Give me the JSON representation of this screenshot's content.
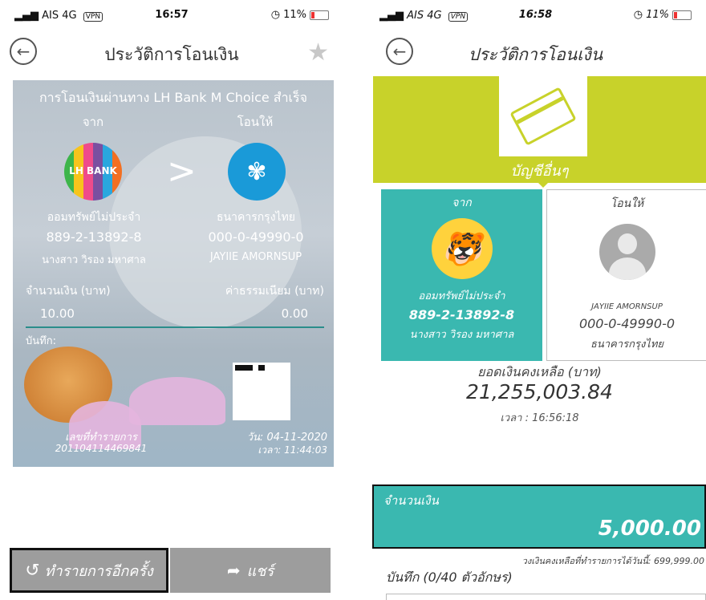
{
  "left": {
    "status": {
      "carrier": "AIS",
      "network": "4G",
      "vpn": "VPN",
      "time": "16:57",
      "battery": "11%"
    },
    "nav": {
      "title": "ประวัติการโอนเงิน"
    },
    "slip": {
      "headline": "การโอนเงินผ่านทาง LH Bank M Choice สำเร็จ",
      "from_label": "จาก",
      "to_label": "โอนให้",
      "from_logo_text": "LH BANK",
      "from_account_type": "ออมทรัพย์ไม่ประจำ",
      "from_account_no": "889-2-13892-8",
      "from_name": "นางสาว วิรอง มหาศาล",
      "to_bank": "ธนาคารกรุงไทย",
      "to_account_no": "000-0-49990-0",
      "to_name": "JAYIIE AMORNSUP",
      "amount_label": "จำนวนเงิน (บาท)",
      "amount": "10.00",
      "fee_label": "ค่าธรรมเนียม (บาท)",
      "fee": "0.00",
      "memo_label": "บันทึก:",
      "ref_label": "เลขที่ทำรายการ",
      "ref_no": "201104114469841",
      "date_label": "วัน: 04-11-2020",
      "time_label": "เวลา: 11:44:03"
    },
    "buttons": {
      "repeat": "ทำรายการอีกครั้ง",
      "share": "แชร์"
    }
  },
  "right": {
    "status": {
      "carrier": "AIS",
      "network": "4G",
      "vpn": "VPN",
      "time": "16:58",
      "battery": "11%"
    },
    "nav": {
      "title": "ประวัติการโอนเงิน"
    },
    "banner_label": "บัญชีอื่นๆ",
    "from": {
      "label": "จาก",
      "account_type": "ออมทรัพย์ไม่ประจำ",
      "account_no": "889-2-13892-8",
      "name": "นางสาว วิรอง มหาศาล"
    },
    "to": {
      "label": "โอนให้",
      "name": "JAYIIE AMORNSUP",
      "account_no": "000-0-49990-0",
      "bank": "ธนาคารกรุงไทย"
    },
    "balance": {
      "label": "ยอดเงินคงเหลือ (บาท)",
      "value": "21,255,003.84",
      "time": "เวลา : 16:56:18"
    },
    "amount": {
      "label": "จำนวนเงิน",
      "value": "5,000.00"
    },
    "limit_note": "วงเงินคงเหลือที่ทำรายการได้วันนี้: 699,999.00",
    "memo_label": "บันทึก (0/40 ตัวอักษร)"
  }
}
